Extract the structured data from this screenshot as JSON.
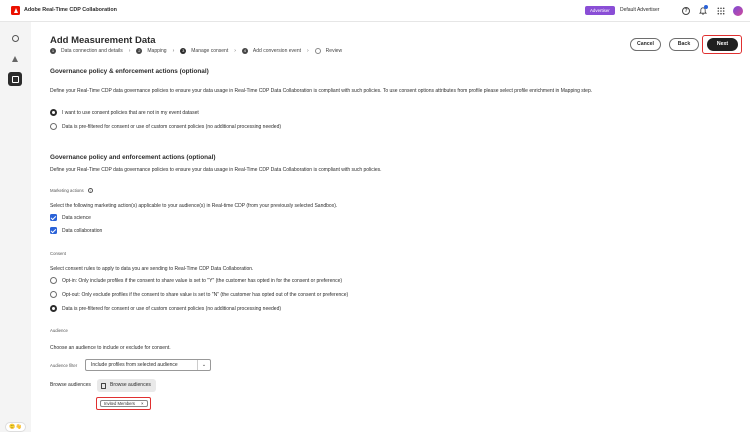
{
  "header": {
    "app_title": "Adobe Real-Time CDP Collaboration",
    "role_badge": "Advertiser",
    "user_name": "Default Advertiser"
  },
  "page": {
    "title": "Add Measurement Data",
    "steps": [
      {
        "num": "1",
        "label": "Data connection and details"
      },
      {
        "num": "2",
        "label": "Mapping"
      },
      {
        "num": "3",
        "label": "Manage consent"
      },
      {
        "num": "4",
        "label": "Add conversion event"
      },
      {
        "num": "",
        "label": "Review"
      }
    ],
    "buttons": {
      "cancel": "Cancel",
      "back": "Back",
      "next": "Next"
    }
  },
  "section1": {
    "heading": "Governance policy & enforcement actions (optional)",
    "description": "Define your Real-Time CDP data governance policies to ensure your data usage in Real-Time CDP Data Collaboration is compliant with such policies. To use consent options attributes from profile please select profile enrichment in Mapping step.",
    "options": [
      {
        "label": "I want to use consent policies that are not in my event dataset",
        "selected": true
      },
      {
        "label": "Data is pre-filtered for consent or use of custom consent policies (no additional processing needed)",
        "selected": false
      }
    ]
  },
  "section2": {
    "heading": "Governance policy and enforcement actions (optional)",
    "description": "Define your Real-Time CDP data governance policies to ensure your data usage in Real-Time CDP Data Collaboration is compliant with such policies.",
    "marketing_actions_label": "Marketing actions",
    "marketing_actions_info": "i",
    "marketing_actions_text": "Select the following marketing action(s) applicable to your audience(s) in Real-time CDP (from your previously selected Sandbox).",
    "marketing_actions": [
      {
        "label": "Data science",
        "checked": true
      },
      {
        "label": "Data collaboration",
        "checked": true
      }
    ],
    "consent_label": "Consent",
    "consent_text": "Select consent rules to apply to data you are sending to Real-Time CDP Data Collaboration.",
    "consent_options": [
      {
        "label": "Opt-in: Only include profiles if the consent to share value is set to \"Y\" (the customer has opted in for the consent or preference)",
        "selected": false
      },
      {
        "label": "Opt-out: Only exclude profiles if the consent to share value is set to \"N\" (the customer has opted out of the consent or preference)",
        "selected": false
      },
      {
        "label": "Data is pre-filtered for consent or use of custom consent policies (no additional processing needed)",
        "selected": true
      }
    ],
    "audience_label": "Audience",
    "audience_text": "Choose an audience to include or exclude for consent.",
    "audience_filter_label": "Audience filter",
    "audience_filter_value": "Include profiles from selected audience",
    "browse_label": "Browse audiences",
    "browse_button": "Browse audiences",
    "selected_tag": "Invited Members",
    "tag_remove": "×"
  },
  "rail": {
    "pill": "🙂👋",
    "expand": "»"
  }
}
